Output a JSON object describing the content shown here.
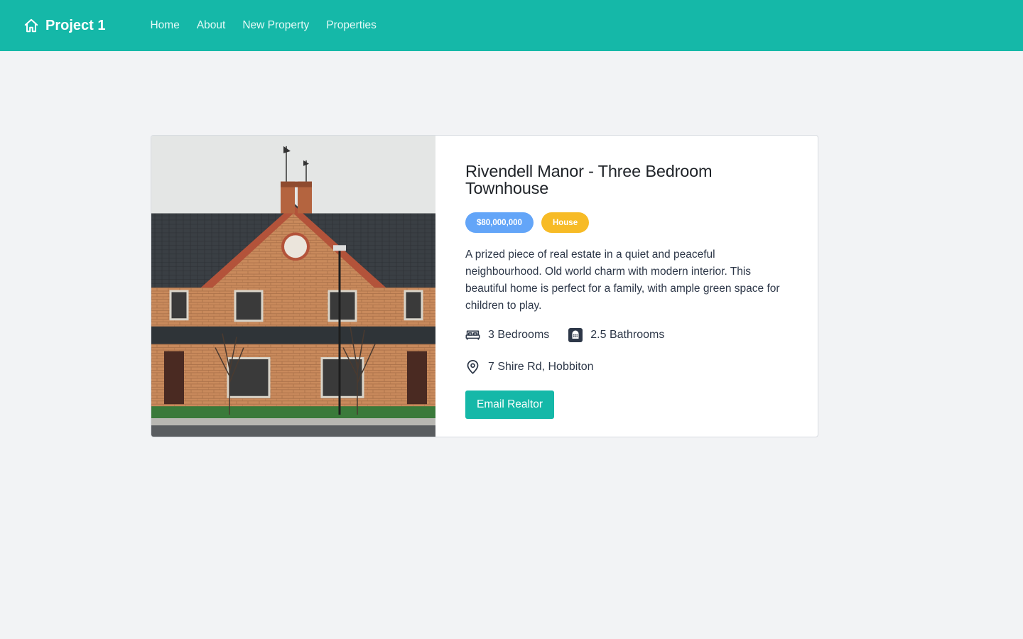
{
  "nav": {
    "brand_name": "Project 1",
    "brand_icon": "home-icon",
    "links": [
      "Home",
      "About",
      "New Property",
      "Properties"
    ]
  },
  "property": {
    "title": "Rivendell Manor - Three Bedroom Townhouse",
    "price": "$80,000,000",
    "type": "House",
    "description": "A prized piece of real estate in a quiet and peaceful neighbourhood.  Old world charm with modern interior. This beautiful home is perfect for a family, with ample green space for children to play.",
    "bedrooms": "3 Bedrooms",
    "bathrooms": "2.5 Bathrooms",
    "address": "7 Shire Rd, Hobbiton",
    "email_button": "Email Realtor"
  },
  "colors": {
    "primary": "#15b8a8",
    "price_badge": "#63a5f8",
    "type_badge": "#f7bb26",
    "background": "#f2f3f5"
  }
}
